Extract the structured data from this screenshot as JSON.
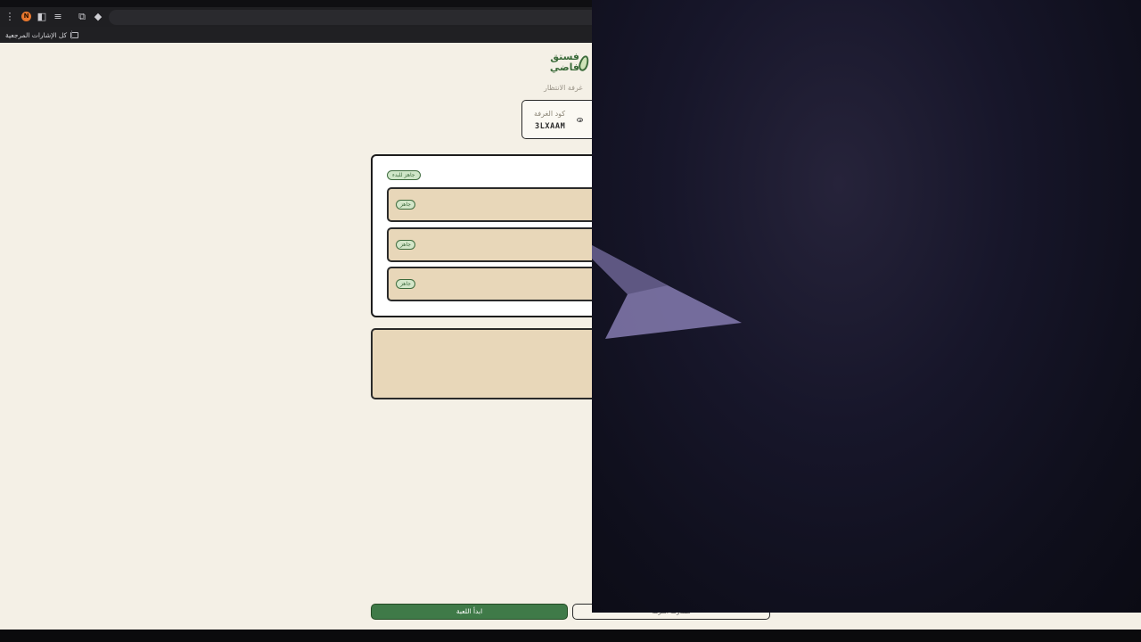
{
  "browser": {
    "profile_initial": "N",
    "bookmarks_all_label": "كل الإشارات المرجعية"
  },
  "app": {
    "logo_text": "فستق فاضي",
    "waiting_room_label": "غرفة الانتظار",
    "room_code_label": "كود الغرفة",
    "room_code_value": "3LXAAM",
    "ready_to_start_label": "جاهز للبدء",
    "players": [
      {
        "status": "جاهز"
      },
      {
        "status": "جاهز"
      },
      {
        "status": "جاهز"
      }
    ],
    "start_game_button": "ابدأ اللعبة",
    "share_room_button": "مشاركة الغرفة"
  }
}
